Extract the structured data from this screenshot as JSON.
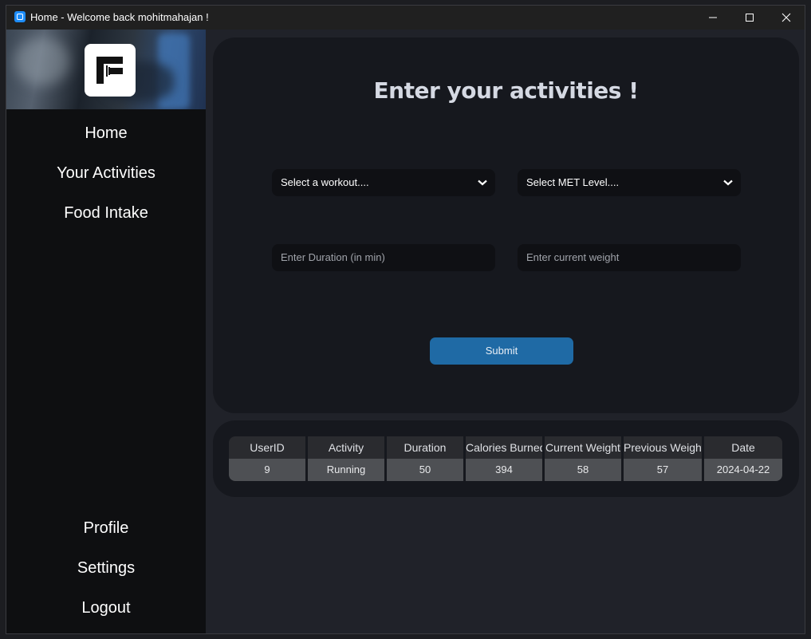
{
  "window": {
    "title": "Home - Welcome back mohitmahajan !",
    "controls": [
      "minimize",
      "maximize",
      "close"
    ]
  },
  "sidebar": {
    "top_items": [
      {
        "label": "Home"
      },
      {
        "label": "Your Activities"
      },
      {
        "label": "Food Intake"
      }
    ],
    "bottom_items": [
      {
        "label": "Profile"
      },
      {
        "label": "Settings"
      },
      {
        "label": "Logout"
      }
    ]
  },
  "form": {
    "title": "Enter your activities !",
    "workout_select": "Select a workout....",
    "met_select": "Select MET Level....",
    "duration_placeholder": "Enter Duration (in min)",
    "weight_placeholder": "Enter current weight",
    "submit_label": "Submit"
  },
  "table": {
    "headers": [
      "UserID",
      "Activity",
      "Duration",
      "Calories Burned",
      "Current Weight",
      "Previous Weight",
      "Date"
    ],
    "rows": [
      [
        "9",
        "Running",
        "50",
        "394",
        "58",
        "57",
        "2024-04-22"
      ]
    ]
  },
  "colors": {
    "accent": "#1f6aa5",
    "sidebar_bg": "#0e0f11",
    "panel_bg": "#16181e",
    "window_bg": "#202229"
  }
}
